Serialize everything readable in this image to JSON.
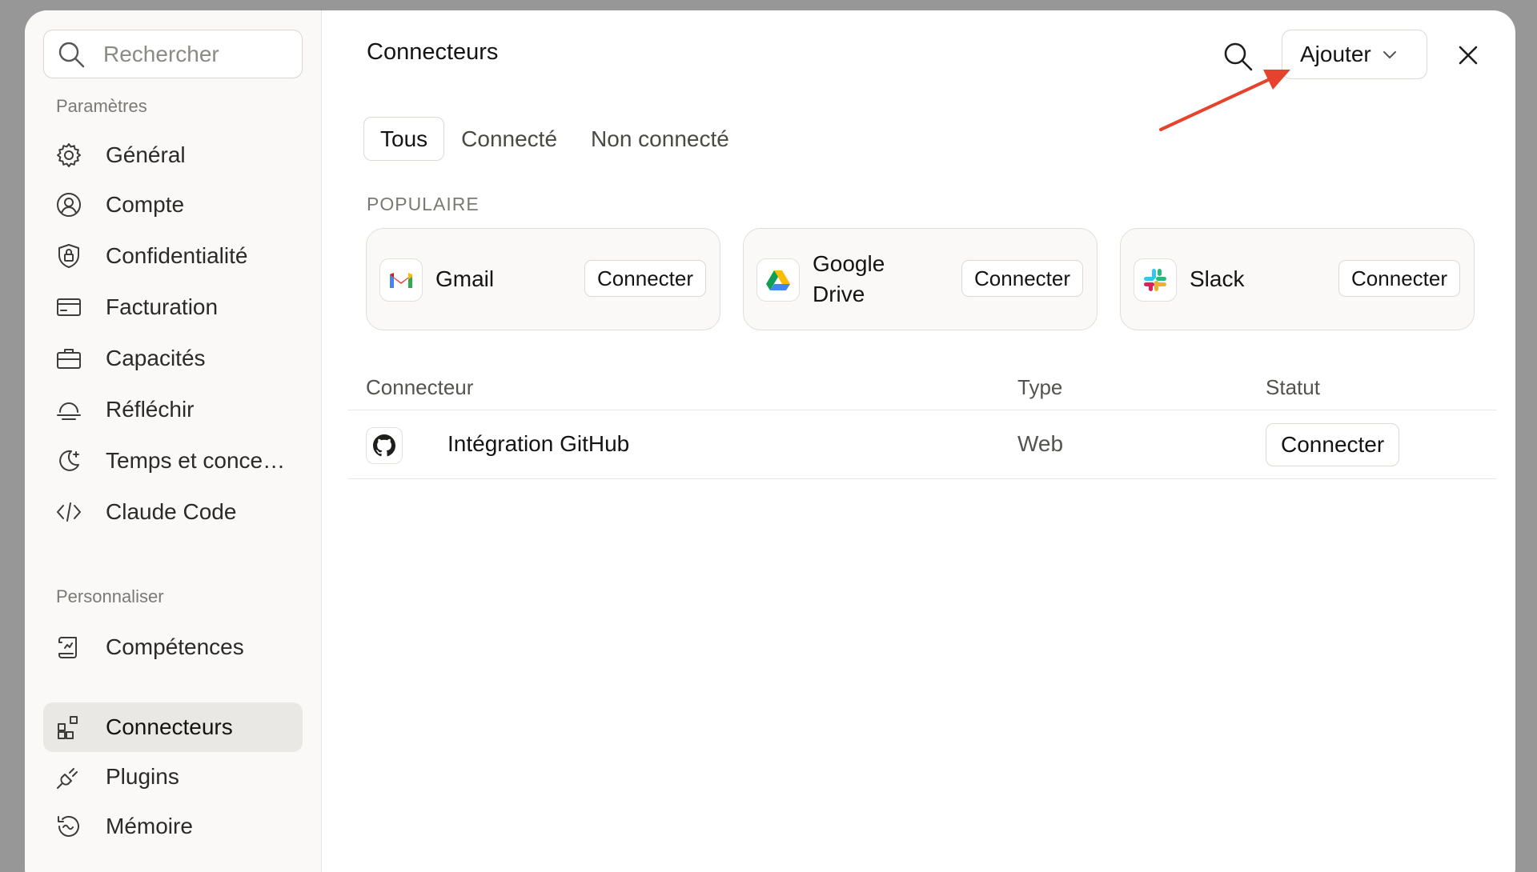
{
  "sidebar": {
    "search_placeholder": "Rechercher",
    "section_settings": "Paramètres",
    "section_personalize": "Personnaliser",
    "items": [
      {
        "label": "Général",
        "icon": "gear-icon"
      },
      {
        "label": "Compte",
        "icon": "user-circle-icon"
      },
      {
        "label": "Confidentialité",
        "icon": "shield-lock-icon"
      },
      {
        "label": "Facturation",
        "icon": "credit-card-icon"
      },
      {
        "label": "Capacités",
        "icon": "briefcase-icon"
      },
      {
        "label": "Réfléchir",
        "icon": "thinking-icon"
      },
      {
        "label": "Temps et concentration",
        "icon": "moon-sparkle-icon"
      },
      {
        "label": "Claude Code",
        "icon": "code-icon"
      }
    ],
    "personalize_items": [
      {
        "label": "Compétences",
        "icon": "scroll-icon"
      },
      {
        "label": "Connecteurs",
        "icon": "connectors-icon",
        "active": true
      },
      {
        "label": "Plugins",
        "icon": "plug-icon"
      },
      {
        "label": "Mémoire",
        "icon": "memory-icon"
      }
    ]
  },
  "header": {
    "title": "Connecteurs",
    "add_label": "Ajouter"
  },
  "tabs": [
    {
      "label": "Tous",
      "active": true
    },
    {
      "label": "Connecté"
    },
    {
      "label": "Non connecté"
    }
  ],
  "popular": {
    "label": "POPULAIRE",
    "cards": [
      {
        "name": "Gmail",
        "button": "Connecter",
        "icon": "gmail-icon"
      },
      {
        "name_line1": "Google",
        "name_line2": "Drive",
        "button": "Connecter",
        "icon": "google-drive-icon"
      },
      {
        "name": "Slack",
        "button": "Connecter",
        "icon": "slack-icon"
      }
    ]
  },
  "table": {
    "headers": {
      "connector": "Connecteur",
      "type": "Type",
      "status": "Statut"
    },
    "rows": [
      {
        "name": "Intégration GitHub",
        "type": "Web",
        "action": "Connecter",
        "icon": "github-icon"
      }
    ]
  },
  "colors": {
    "accent_arrow": "#e5432d",
    "active_nav_bg": "#e9e8e4",
    "sidebar_bg": "#faf9f7"
  }
}
